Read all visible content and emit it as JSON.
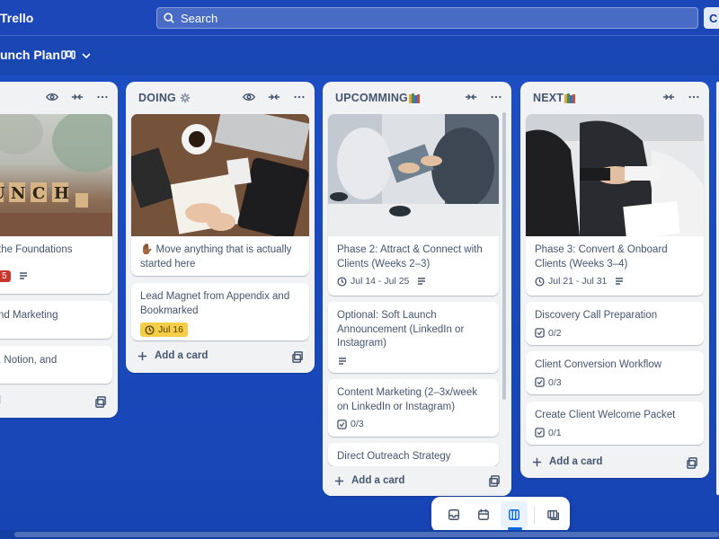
{
  "app": {
    "name": "Trello"
  },
  "search": {
    "placeholder": "Search"
  },
  "create_button": {
    "label": "C"
  },
  "board": {
    "title": "unch Plan"
  },
  "lists": [
    {
      "title": "",
      "cards": [
        {
          "cover": "launch-scrabble-tiles",
          "title": "the Foundations",
          "due_badge": "5"
        },
        {
          "title": "nd Marketing"
        },
        {
          "title": ", Notion, and"
        }
      ],
      "add_card": "d"
    },
    {
      "title": "DOING",
      "cards": [
        {
          "cover": "desk-notebook",
          "title": "✋🏾 Move anything that is actually started here"
        },
        {
          "title": "Lead Magnet from Appendix and Bookmarked",
          "due": "Jul 16"
        }
      ],
      "add_card": "Add a card"
    },
    {
      "title": "UPCOMMING",
      "cards": [
        {
          "cover": "meeting-tablet",
          "title": "Phase 2: Attract & Connect with Clients (Weeks 2–3)",
          "due": "Jul 14 - Jul 25"
        },
        {
          "title": "Optional: Soft Launch Announcement (LinkedIn or Instagram)"
        },
        {
          "title": "Content Marketing (2–3x/week on LinkedIn or Instagram)",
          "checklist": "0/3"
        },
        {
          "title": "Direct Outreach Strategy"
        }
      ],
      "add_card": "Add a card"
    },
    {
      "title": "NEXT",
      "cards": [
        {
          "cover": "handshake",
          "title": "Phase 3: Convert & Onboard Clients (Weeks 3–4)",
          "due": "Jul 21 - Jul 31"
        },
        {
          "title": "Discovery Call Preparation",
          "checklist": "0/2"
        },
        {
          "title": "Client Conversion Workflow",
          "checklist": "0/3"
        },
        {
          "title": "Create Client Welcome Packet",
          "checklist": "0/1"
        }
      ],
      "add_card": "Add a card"
    }
  ],
  "colors": {
    "background": "#1a4bbf",
    "list_bg": "#f1f2f4",
    "due_yellow": "#f5cd47",
    "due_red": "#c9372c",
    "accent": "#0c66e4"
  },
  "switcher": {
    "icons": [
      "inbox-icon",
      "calendar-icon",
      "board-icon",
      "switch-boards-icon"
    ],
    "active": "board-icon"
  }
}
